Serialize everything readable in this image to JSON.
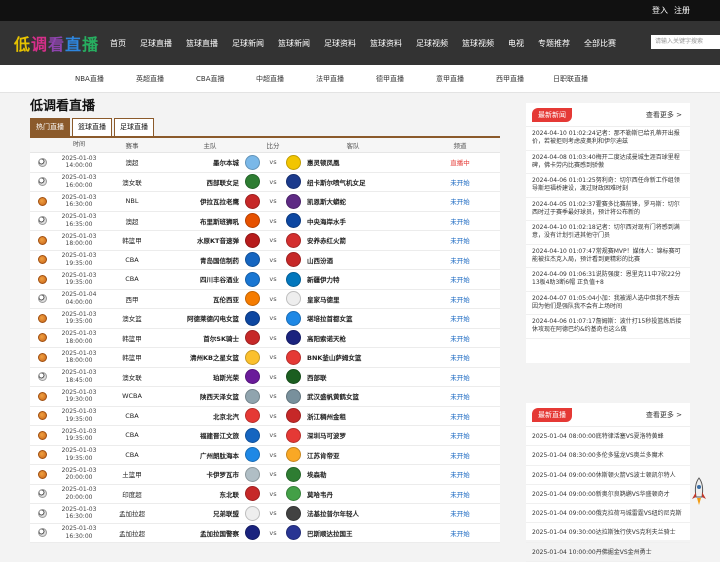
{
  "top": {
    "login": "登入",
    "register": "注册"
  },
  "logo": {
    "chars": [
      "低",
      "调",
      "看",
      "直",
      "播"
    ],
    "colors": [
      "#e6c200",
      "#d62f8a",
      "#8e44ad",
      "#2e86de",
      "#27ae60"
    ]
  },
  "nav": [
    "首页",
    "足球直播",
    "篮球直播",
    "足球新闻",
    "篮球新闻",
    "足球资料",
    "篮球资料",
    "足球视频",
    "篮球视频",
    "电视",
    "专题推荐",
    "全部比赛"
  ],
  "search": {
    "placeholder": "请输入关键字搜索"
  },
  "subnav": [
    "NBA直播",
    "英超直播",
    "CBA直播",
    "中超直播",
    "法甲直播",
    "德甲直播",
    "意甲直播",
    "西甲直播",
    "日职联直播"
  ],
  "main": {
    "title": "低调看直播",
    "tabs": [
      "热门直播",
      "篮球直播",
      "足球直播"
    ],
    "headers": [
      "时间",
      "赛事",
      "主队",
      "比分",
      "客队",
      "频道"
    ]
  },
  "matches": [
    {
      "date": "2025-01-03",
      "time": "14:00:00",
      "league": "澳超",
      "home": "墨尔本城",
      "away": "惠灵顿凤凰",
      "status": "直播中",
      "live": true,
      "sport": "fb",
      "hc": "#7ab8e8",
      "ac": "#f2c500"
    },
    {
      "date": "2025-01-03",
      "time": "16:00:00",
      "league": "澳女联",
      "home": "西部联女足",
      "away": "纽卡斯尔喷气机女足",
      "status": "未开始",
      "live": false,
      "sport": "fb",
      "hc": "#2e7d32",
      "ac": "#1b3a8c"
    },
    {
      "date": "2025-01-03",
      "time": "16:30:00",
      "league": "NBL",
      "home": "伊拉瓦拉老鹰",
      "away": "凯恩斯大蟒蛇",
      "status": "未开始",
      "live": false,
      "sport": "bb",
      "hc": "#c62828",
      "ac": "#5e2a84"
    },
    {
      "date": "2025-01-03",
      "time": "16:35:00",
      "league": "澳超",
      "home": "布里斯班狮吼",
      "away": "中央海岸水手",
      "status": "未开始",
      "live": false,
      "sport": "fb",
      "hc": "#e65100",
      "ac": "#0d47a1"
    },
    {
      "date": "2025-01-03",
      "time": "18:00:00",
      "league": "韩篮甲",
      "home": "水原KT音速弹",
      "away": "安养赤红火箭",
      "status": "未开始",
      "live": false,
      "sport": "bb",
      "hc": "#b71c1c",
      "ac": "#d32f2f"
    },
    {
      "date": "2025-01-03",
      "time": "19:35:00",
      "league": "CBA",
      "home": "青岛国信制药",
      "away": "山西汾酒",
      "status": "未开始",
      "live": false,
      "sport": "bb",
      "hc": "#1565c0",
      "ac": "#c62828"
    },
    {
      "date": "2025-01-03",
      "time": "19:35:00",
      "league": "CBA",
      "home": "四川丰谷酒业",
      "away": "新疆伊力特",
      "status": "未开始",
      "live": false,
      "sport": "bb",
      "hc": "#1976d2",
      "ac": "#0277bd"
    },
    {
      "date": "2025-01-04",
      "time": "04:00:00",
      "league": "西甲",
      "home": "瓦伦西亚",
      "away": "皇家马德里",
      "status": "未开始",
      "live": false,
      "sport": "fb",
      "hc": "#f57c00",
      "ac": "#eeeeee"
    },
    {
      "date": "2025-01-03",
      "time": "19:35:00",
      "league": "澳女篮",
      "home": "阿德莱德闪电女篮",
      "away": "堪培拉首都女篮",
      "status": "未开始",
      "live": false,
      "sport": "bb",
      "hc": "#0d47a1",
      "ac": "#1e88e5"
    },
    {
      "date": "2025-01-03",
      "time": "18:00:00",
      "league": "韩篮甲",
      "home": "首尔SK骑士",
      "away": "高阳索诺天枪",
      "status": "未开始",
      "live": false,
      "sport": "bb",
      "hc": "#c62828",
      "ac": "#1a237e"
    },
    {
      "date": "2025-01-03",
      "time": "18:00:00",
      "league": "韩篮甲",
      "home": "清州KB之星女篮",
      "away": "BNK釜山萨姆女篮",
      "status": "未开始",
      "live": false,
      "sport": "bb",
      "hc": "#fbc02d",
      "ac": "#e53935"
    },
    {
      "date": "2025-01-03",
      "time": "18:45:00",
      "league": "澳女联",
      "home": "珀斯光荣",
      "away": "西部联",
      "status": "未开始",
      "live": false,
      "sport": "fb",
      "hc": "#6a1b9a",
      "ac": "#1b5e20"
    },
    {
      "date": "2025-01-03",
      "time": "19:30:00",
      "league": "WCBA",
      "home": "陕西天泽女篮",
      "away": "武汉盛帆黄鹤女篮",
      "status": "未开始",
      "live": false,
      "sport": "bb",
      "hc": "#90a4ae",
      "ac": "#78909c"
    },
    {
      "date": "2025-01-03",
      "time": "19:35:00",
      "league": "CBA",
      "home": "北京北汽",
      "away": "浙江稠州金租",
      "status": "未开始",
      "live": false,
      "sport": "bb",
      "hc": "#e53935",
      "ac": "#c62828"
    },
    {
      "date": "2025-01-03",
      "time": "19:35:00",
      "league": "CBA",
      "home": "福建晋江文旅",
      "away": "深圳马可波罗",
      "status": "未开始",
      "live": false,
      "sport": "bb",
      "hc": "#1565c0",
      "ac": "#e53935"
    },
    {
      "date": "2025-01-03",
      "time": "19:35:00",
      "league": "CBA",
      "home": "广州朗肽海本",
      "away": "江苏肯帝亚",
      "status": "未开始",
      "live": false,
      "sport": "bb",
      "hc": "#1e88e5",
      "ac": "#f9a825"
    },
    {
      "date": "2025-01-03",
      "time": "20:00:00",
      "league": "土篮甲",
      "home": "卡伊罗瓦市",
      "away": "埃森勒",
      "status": "未开始",
      "live": false,
      "sport": "bb",
      "hc": "#b0bec5",
      "ac": "#2e7d32"
    },
    {
      "date": "2025-01-03",
      "time": "20:00:00",
      "league": "印度超",
      "home": "东北联",
      "away": "莫哈韦丹",
      "status": "未开始",
      "live": false,
      "sport": "fb",
      "hc": "#c62828",
      "ac": "#43a047"
    },
    {
      "date": "2025-01-03",
      "time": "16:30:00",
      "league": "孟加拉超",
      "home": "兄弟联盟",
      "away": "法基拉普尔年轻人",
      "status": "未开始",
      "live": false,
      "sport": "fb",
      "hc": "#eeeeee",
      "ac": "#424242"
    },
    {
      "date": "2025-01-03",
      "time": "16:30:00",
      "league": "孟加拉超",
      "home": "孟加拉国警察",
      "away": "巴斯顺达拉国王",
      "status": "未开始",
      "live": false,
      "sport": "fb",
      "hc": "#1a237e",
      "ac": "#283593"
    }
  ],
  "side_news": {
    "tag": "最新新闻",
    "more": "查看更多 >",
    "items": [
      "2024-04-10 01:02:24记者：那不勒斯已给孔蒂开出报价，若被拒则考虑皮奥利和伊尔迪兹",
      "2024-04-08 01:03:40梅开二度达成曼城生涯百球里程碑，佛卡劳内比赛感到骄傲",
      "2024-04-06 01:01:25努利奇：切尔西任命新工作组领导斯坦福桥建设，渡过财政困难时刻",
      "2024-04-05 01:02:37霍赛多比赛前锋，罗马斯：切尔西时过于赛季最好球员，预计将公布新的",
      "2024-04-10 01:02:18记者：切尔西对现有门将感到满意，没有计划引进其他守门员",
      "2024-04-10 01:07:47常规赛MVP！媒体人：锦标赛可能被拉杰克入局，预计看到更精彩的比赛",
      "2024-04-09 01:06:31说防强度：恩里克11中7砍22分13板4助3断6帽 正负值+8",
      "2024-04-07 01:05:04小加：我被湖人选中但我不想去 因为他们是强队我不会有上场时间",
      "2024-04-06 01:07:17詹姆斯：波什打15秒投篮练后接休攻现在阿德巴约&约基奇也这么做"
    ]
  },
  "side_matches": {
    "tag": "最新直播",
    "more": "查看更多 >",
    "items": [
      "2025-01-04 08:00:00底特律活塞VS夏洛特黄蜂",
      "2025-01-04 08:30:00多伦多猛龙VS奥兰多魔术",
      "2025-01-04 09:00:00休斯顿火箭VS波士顿凯尔特人",
      "2025-01-04 09:00:00新奥尔良鹈鹕VS华盛顿奇才",
      "2025-01-04 09:00:00俄克拉荷马城雷霆VS纽约尼克斯",
      "2025-01-04 09:30:00达拉斯独行侠VS克利夫兰骑士",
      "2025-01-04 10:00:00丹佛掘金VS金州勇士"
    ]
  }
}
